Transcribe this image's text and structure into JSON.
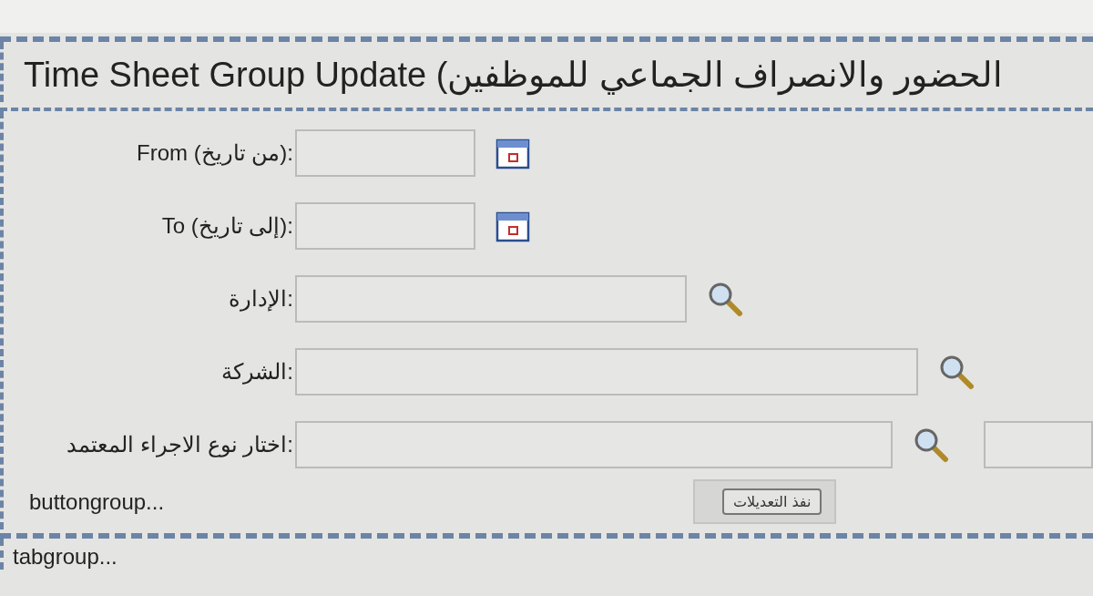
{
  "window": {
    "title": "Time Sheet Group Update (الحضور والانصراف الجماعي للموظفين"
  },
  "fields": [
    {
      "label": "From (من تاريخ):",
      "kind": "date"
    },
    {
      "label": "To (إلى تاريخ):",
      "kind": "date"
    },
    {
      "label": "الإدارة:",
      "kind": "lookup"
    },
    {
      "label": "الشركة:",
      "kind": "lookup"
    },
    {
      "label": "اختار نوع الاجراء المعتمد:",
      "kind": "lookup_extra"
    }
  ],
  "button_group": {
    "label": "buttongroup...",
    "buttons": [
      "نفذ التعديلات"
    ]
  },
  "tab_group": {
    "label": "tabgroup..."
  }
}
